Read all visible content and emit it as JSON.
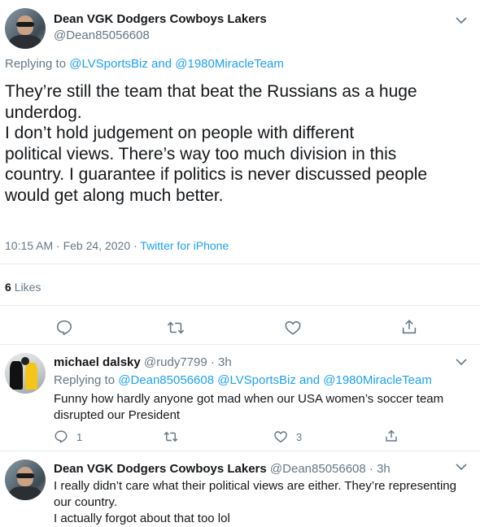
{
  "main_tweet": {
    "display_name": "Dean VGK Dodgers Cowboys Lakers",
    "handle": "@Dean85056608",
    "replying_prefix": "Replying to",
    "replying_to_1": "@LVSportsBiz",
    "replying_and": "and",
    "replying_to_2": "@1980MiracleTeam",
    "text_lines": [
      "They’re still the team that beat the Russians as a huge",
      "underdog.",
      "I don’t hold judgement on people with different",
      "political views. There’s way too much division in this",
      "country. I guarantee if politics is never discussed people",
      "would get along much better."
    ],
    "timestamp": "10:15 AM · Feb 24, 2020 ·",
    "source": "Twitter for iPhone",
    "likes_count": "6",
    "likes_label": "Likes"
  },
  "reply_1": {
    "display_name": "michael dalsky",
    "handle": "@rudy7799",
    "time": "· 3h",
    "replying_prefix": "Replying to",
    "replying_to_1": "@Dean85056608",
    "replying_to_2": "@LVSportsBiz",
    "replying_and": "and",
    "replying_to_3": "@1980MiracleTeam",
    "text_lines": [
      "Funny how hardly anyone got mad when our USA women’s soccer team",
      "disrupted our President"
    ],
    "reply_count": "1",
    "like_count": "3"
  },
  "reply_2": {
    "display_name": "Dean VGK Dodgers Cowboys Lakers",
    "handle": "@Dean85056608",
    "time": "· 3h",
    "text_lines": [
      "I really didn’t care what their political views are either. They’re representing",
      "our country.",
      "I actually forgot about that too lol"
    ]
  },
  "colors": {
    "link": "#1da1f2",
    "muted": "#657786",
    "text": "#14171a",
    "divider": "#e6ecf0"
  },
  "icons": {
    "reply": "speech-bubble-icon",
    "retweet": "retweet-icon",
    "like": "heart-icon",
    "share": "share-icon",
    "menu": "chevron-down-icon"
  }
}
